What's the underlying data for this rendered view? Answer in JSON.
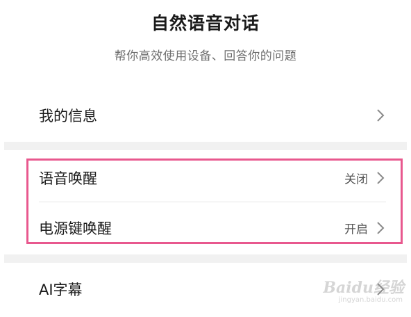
{
  "header": {
    "title": "自然语音对话",
    "subtitle": "帮你高效使用设备、回答你的问题"
  },
  "rows": [
    {
      "label": "我的信息",
      "value": "",
      "icon": "chevron-right-icon"
    },
    {
      "label": "语音唤醒",
      "value": "关闭",
      "icon": "chevron-right-icon"
    },
    {
      "label": "电源键唤醒",
      "value": "开启",
      "icon": "chevron-right-icon"
    },
    {
      "label": "AI字幕",
      "value": "",
      "icon": "chevron-right-icon"
    }
  ],
  "highlight_color": "#e8588e",
  "watermark": {
    "text": "Baidu经验",
    "url_text": "jingyan.baidu.com"
  }
}
